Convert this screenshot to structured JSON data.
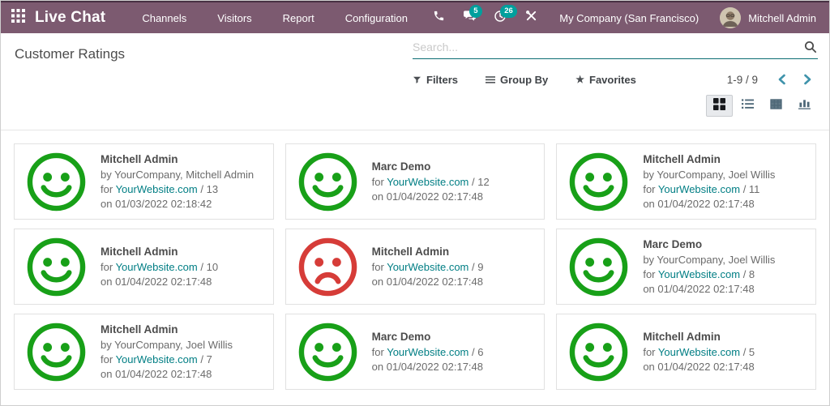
{
  "navbar": {
    "brand": "Live Chat",
    "menu": [
      "Channels",
      "Visitors",
      "Report",
      "Configuration"
    ],
    "messages_badge": "5",
    "activities_badge": "26",
    "company": "My Company (San Francisco)",
    "user": "Mitchell Admin"
  },
  "control_panel": {
    "title": "Customer Ratings",
    "search_placeholder": "Search...",
    "filters_label": "Filters",
    "group_by_label": "Group By",
    "favorites_label": "Favorites",
    "pager_value": "1-9 / 9"
  },
  "colors": {
    "navbar_bg": "#7c5a70",
    "badge_teal": "#00a09d",
    "link_teal": "#017e84",
    "happy_green": "#18a018",
    "sad_red": "#d63c38"
  },
  "cards": [
    {
      "mood": "happy",
      "name": "Mitchell Admin",
      "by": "by YourCompany, Mitchell Admin",
      "for_prefix": "for",
      "site": "YourWebsite.com",
      "for_suffix": "/ 13",
      "date": "on 01/03/2022 02:18:42"
    },
    {
      "mood": "happy",
      "name": "Marc Demo",
      "by": "",
      "for_prefix": "for",
      "site": "YourWebsite.com",
      "for_suffix": "/ 12",
      "date": "on 01/04/2022 02:17:48"
    },
    {
      "mood": "happy",
      "name": "Mitchell Admin",
      "by": "by YourCompany, Joel Willis",
      "for_prefix": "for",
      "site": "YourWebsite.com",
      "for_suffix": "/ 11",
      "date": "on 01/04/2022 02:17:48"
    },
    {
      "mood": "happy",
      "name": "Mitchell Admin",
      "by": "",
      "for_prefix": "for",
      "site": "YourWebsite.com",
      "for_suffix": "/ 10",
      "date": "on 01/04/2022 02:17:48"
    },
    {
      "mood": "sad",
      "name": "Mitchell Admin",
      "by": "",
      "for_prefix": "for",
      "site": "YourWebsite.com",
      "for_suffix": "/ 9",
      "date": "on 01/04/2022 02:17:48"
    },
    {
      "mood": "happy",
      "name": "Marc Demo",
      "by": "by YourCompany, Joel Willis",
      "for_prefix": "for",
      "site": "YourWebsite.com",
      "for_suffix": "/ 8",
      "date": "on 01/04/2022 02:17:48"
    },
    {
      "mood": "happy",
      "name": "Mitchell Admin",
      "by": "by YourCompany, Joel Willis",
      "for_prefix": "for",
      "site": "YourWebsite.com",
      "for_suffix": "/ 7",
      "date": "on 01/04/2022 02:17:48"
    },
    {
      "mood": "happy",
      "name": "Marc Demo",
      "by": "",
      "for_prefix": "for",
      "site": "YourWebsite.com",
      "for_suffix": "/ 6",
      "date": "on 01/04/2022 02:17:48"
    },
    {
      "mood": "happy",
      "name": "Mitchell Admin",
      "by": "",
      "for_prefix": "for",
      "site": "YourWebsite.com",
      "for_suffix": "/ 5",
      "date": "on 01/04/2022 02:17:48"
    }
  ]
}
